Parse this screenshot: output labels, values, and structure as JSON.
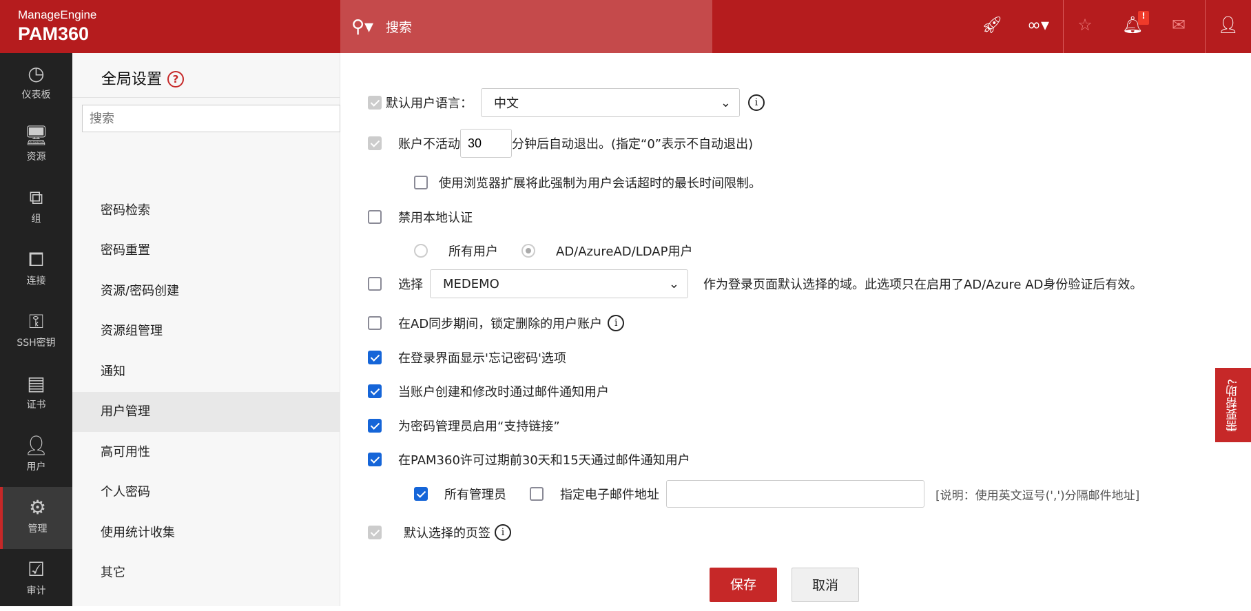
{
  "header": {
    "brand": "ManageEngine",
    "product": "PAM360",
    "search_placeholder": "搜索",
    "notification_badge": "!"
  },
  "sidebar": [
    {
      "label": "仪表板",
      "icon": "dashboard-icon"
    },
    {
      "label": "资源",
      "icon": "monitor-icon"
    },
    {
      "label": "组",
      "icon": "group-icon"
    },
    {
      "label": "连接",
      "icon": "connect-icon"
    },
    {
      "label": "SSH密钥",
      "icon": "ssh-key-icon"
    },
    {
      "label": "证书",
      "icon": "certificate-icon"
    },
    {
      "label": "用户",
      "icon": "user-icon"
    },
    {
      "label": "管理",
      "icon": "gear-icon",
      "active": true
    },
    {
      "label": "审计",
      "icon": "audit-icon"
    }
  ],
  "nav": {
    "title": "全局设置",
    "help": "?",
    "search_placeholder": "搜索",
    "items": [
      "密码检索",
      "密码重置",
      "资源/密码创建",
      "资源组管理",
      "通知",
      "用户管理",
      "高可用性",
      "个人密码",
      "使用统计收集",
      "其它"
    ],
    "active": "用户管理"
  },
  "form": {
    "lang_label": "默认用户语言：",
    "lang_value": "中文",
    "inactive_label": "账户不活动",
    "inactive_value": "30",
    "inactive_suffix": "分钟后自动退出。(指定“0”表示不自动退出)",
    "browser_ext": "使用浏览器扩展将此强制为用户会话超时的最长时间限制。",
    "disable_local": "禁用本地认证",
    "radio_all": "所有用户",
    "radio_ad": "AD/AzureAD/LDAP用户",
    "select_label": "选择",
    "domain_value": "MEDEMO",
    "domain_suffix": "作为登录页面默认选择的域。此选项只在启用了AD/Azure AD身份验证后有效。",
    "lock_deleted": "在AD同步期间，锁定删除的用户账户",
    "forgot_pw": "在登录界面显示'忘记密码'选项",
    "notify_create": "当账户创建和修改时通过邮件通知用户",
    "support_link": "为密码管理员启用“支持链接”",
    "license_notify": "在PAM360许可过期前30天和15天通过邮件通知用户",
    "all_admins": "所有管理员",
    "specify_email": "指定电子邮件地址",
    "email_value": "",
    "email_note": "[说明：使用英文逗号(',')分隔邮件地址]",
    "default_tab": "默认选择的页签",
    "save": "保存",
    "cancel": "取消"
  },
  "help_tab": "需要帮助?"
}
